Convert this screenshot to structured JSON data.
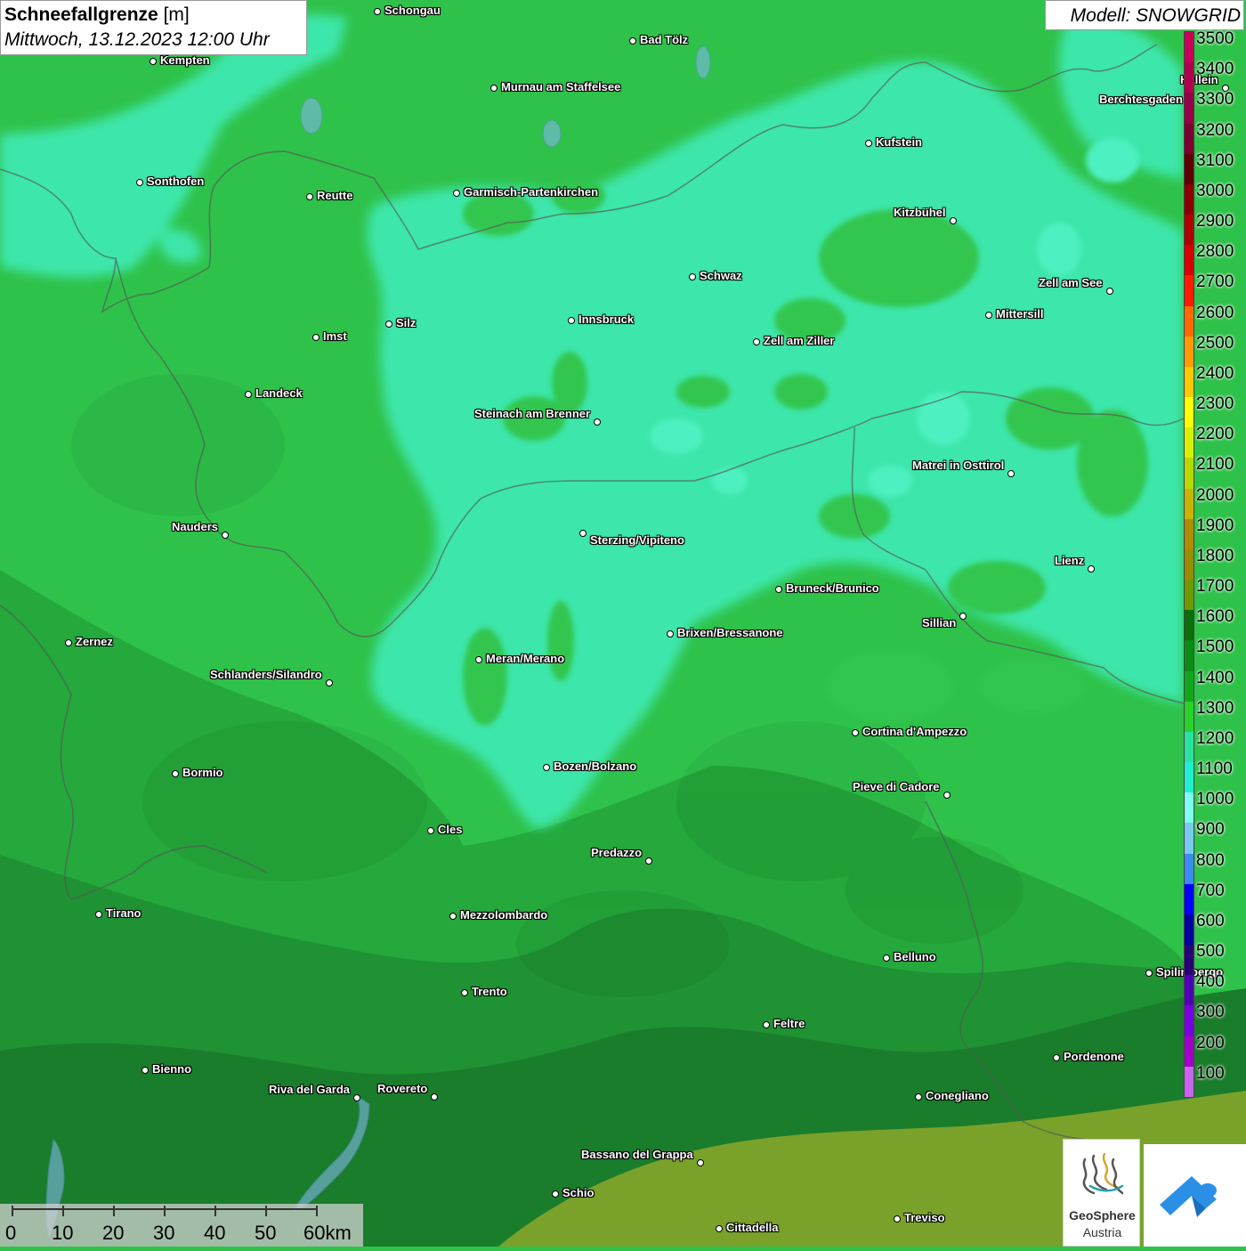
{
  "title": {
    "main_bold": "Schneefallgrenze",
    "main_unit": "[m]",
    "datetime": "Mittwoch, 13.12.2023 12:00 Uhr"
  },
  "model": "Modell: SNOWGRID",
  "legend": {
    "levels": [
      {
        "label": "3500",
        "color": "#c8005a"
      },
      {
        "label": "3400",
        "color": "#b0004e"
      },
      {
        "label": "3300",
        "color": "#960046"
      },
      {
        "label": "3200",
        "color": "#7a0030"
      },
      {
        "label": "3100",
        "color": "#5c0000"
      },
      {
        "label": "3000",
        "color": "#8a0000"
      },
      {
        "label": "2900",
        "color": "#b00000"
      },
      {
        "label": "2800",
        "color": "#d80000"
      },
      {
        "label": "2700",
        "color": "#ff1a00"
      },
      {
        "label": "2600",
        "color": "#ff6a00"
      },
      {
        "label": "2500",
        "color": "#ff9a00"
      },
      {
        "label": "2400",
        "color": "#ffc800"
      },
      {
        "label": "2300",
        "color": "#ffff00"
      },
      {
        "label": "2200",
        "color": "#d8f000"
      },
      {
        "label": "2100",
        "color": "#b8d800"
      },
      {
        "label": "2000",
        "color": "#c8b400"
      },
      {
        "label": "1900",
        "color": "#b08c00"
      },
      {
        "label": "1800",
        "color": "#9a8c00"
      },
      {
        "label": "1700",
        "color": "#6e9a00"
      },
      {
        "label": "1600",
        "color": "#0a6e0a"
      },
      {
        "label": "1500",
        "color": "#0a8c14"
      },
      {
        "label": "1400",
        "color": "#12a81e"
      },
      {
        "label": "1300",
        "color": "#2ad22a"
      },
      {
        "label": "1200",
        "color": "#28e4a0"
      },
      {
        "label": "1100",
        "color": "#20f0d0"
      },
      {
        "label": "1000",
        "color": "#80fff0"
      },
      {
        "label": "900",
        "color": "#78c8f0"
      },
      {
        "label": "800",
        "color": "#3c8cf0"
      },
      {
        "label": "700",
        "color": "#0000ff"
      },
      {
        "label": "600",
        "color": "#0000a0"
      },
      {
        "label": "500",
        "color": "#280078"
      },
      {
        "label": "400",
        "color": "#5000b4"
      },
      {
        "label": "300",
        "color": "#7800e0"
      },
      {
        "label": "200",
        "color": "#a000c8"
      },
      {
        "label": "100",
        "color": "#c864f0"
      }
    ]
  },
  "cities": [
    {
      "name": "Schongau"
    },
    {
      "name": "Bad Tölz"
    },
    {
      "name": "Kempten"
    },
    {
      "name": "Murnau am Staffelsee"
    },
    {
      "name": "Hallein"
    },
    {
      "name": "Berchtesgaden"
    },
    {
      "name": "Kufstein"
    },
    {
      "name": "Sonthofen"
    },
    {
      "name": "Reutte"
    },
    {
      "name": "Garmisch-Partenkirchen"
    },
    {
      "name": "Kitzbühel"
    },
    {
      "name": "Schwaz"
    },
    {
      "name": "Zell am See"
    },
    {
      "name": "Mittersill"
    },
    {
      "name": "Innsbruck"
    },
    {
      "name": "Silz"
    },
    {
      "name": "Imst"
    },
    {
      "name": "Zell am Ziller"
    },
    {
      "name": "Landeck"
    },
    {
      "name": "Steinach am Brenner"
    },
    {
      "name": "Matrei in Osttirol"
    },
    {
      "name": "Nauders"
    },
    {
      "name": "Sterzing/Vipiteno"
    },
    {
      "name": "Lienz"
    },
    {
      "name": "Bruneck/Brunico"
    },
    {
      "name": "Sillian"
    },
    {
      "name": "Brixen/Bressanone"
    },
    {
      "name": "Zernez"
    },
    {
      "name": "Meran/Merano"
    },
    {
      "name": "Schlanders/Silandro"
    },
    {
      "name": "Cortina d'Ampezzo"
    },
    {
      "name": "Bozen/Bolzano"
    },
    {
      "name": "Bormio"
    },
    {
      "name": "Pieve di Cadore"
    },
    {
      "name": "Cles"
    },
    {
      "name": "Predazzo"
    },
    {
      "name": "Tirano"
    },
    {
      "name": "Mezzolombardo"
    },
    {
      "name": "Belluno"
    },
    {
      "name": "Spilimbergo"
    },
    {
      "name": "Trento"
    },
    {
      "name": "Feltre"
    },
    {
      "name": "Pordenone"
    },
    {
      "name": "Bienno"
    },
    {
      "name": "Riva del Garda"
    },
    {
      "name": "Rovereto"
    },
    {
      "name": "Conegliano"
    },
    {
      "name": "Bassano del Grappa"
    },
    {
      "name": "Schio"
    },
    {
      "name": "Treviso"
    },
    {
      "name": "Cittadella"
    }
  ],
  "scalebar": {
    "labels": [
      "0",
      "10",
      "20",
      "30",
      "40",
      "50",
      "60km"
    ]
  },
  "logos": {
    "geosphere_name": "GeoSphere",
    "geosphere_sub": "Austria"
  }
}
